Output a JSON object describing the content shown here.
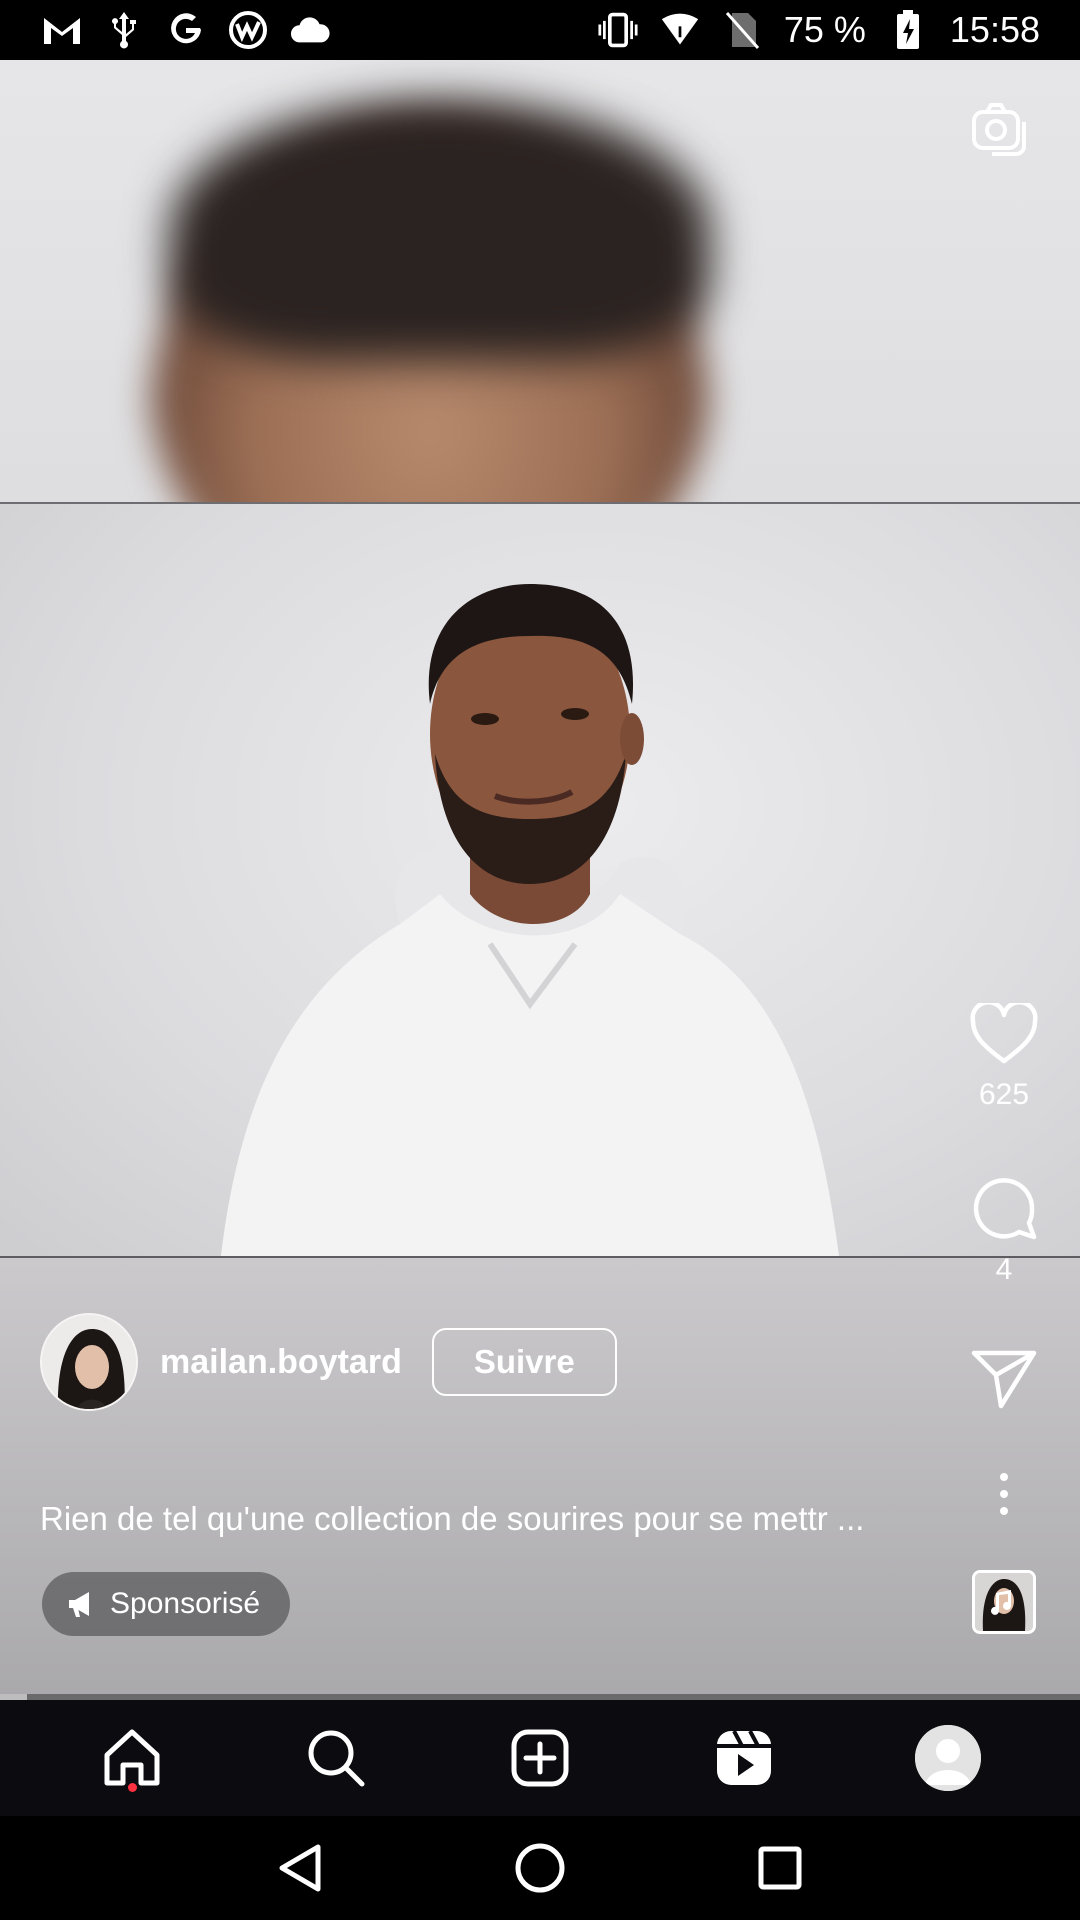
{
  "status_bar": {
    "battery": "75 %",
    "time": "15:58",
    "left_icons": [
      "gmail-icon",
      "usb-icon",
      "google-icon",
      "app-icon",
      "cloud-icon"
    ],
    "right_icons": [
      "vibrate-icon",
      "wifi-icon",
      "no-sim-icon",
      "battery-charging-icon"
    ]
  },
  "reel": {
    "likes": "625",
    "comments": "4",
    "author": {
      "username": "mailan.boytard",
      "follow_label": "Suivre"
    },
    "caption": "Rien de tel qu'une collection de sourires pour se mettr ...",
    "sponsored_label": "Sponsorisé",
    "progress": 0.025
  },
  "bottom_nav": {
    "items": [
      "home-icon",
      "search-icon",
      "create-icon",
      "reels-icon",
      "profile-avatar"
    ]
  },
  "colors": {
    "notification_dot": "#ff3040",
    "nav_background": "#0c0c10"
  }
}
